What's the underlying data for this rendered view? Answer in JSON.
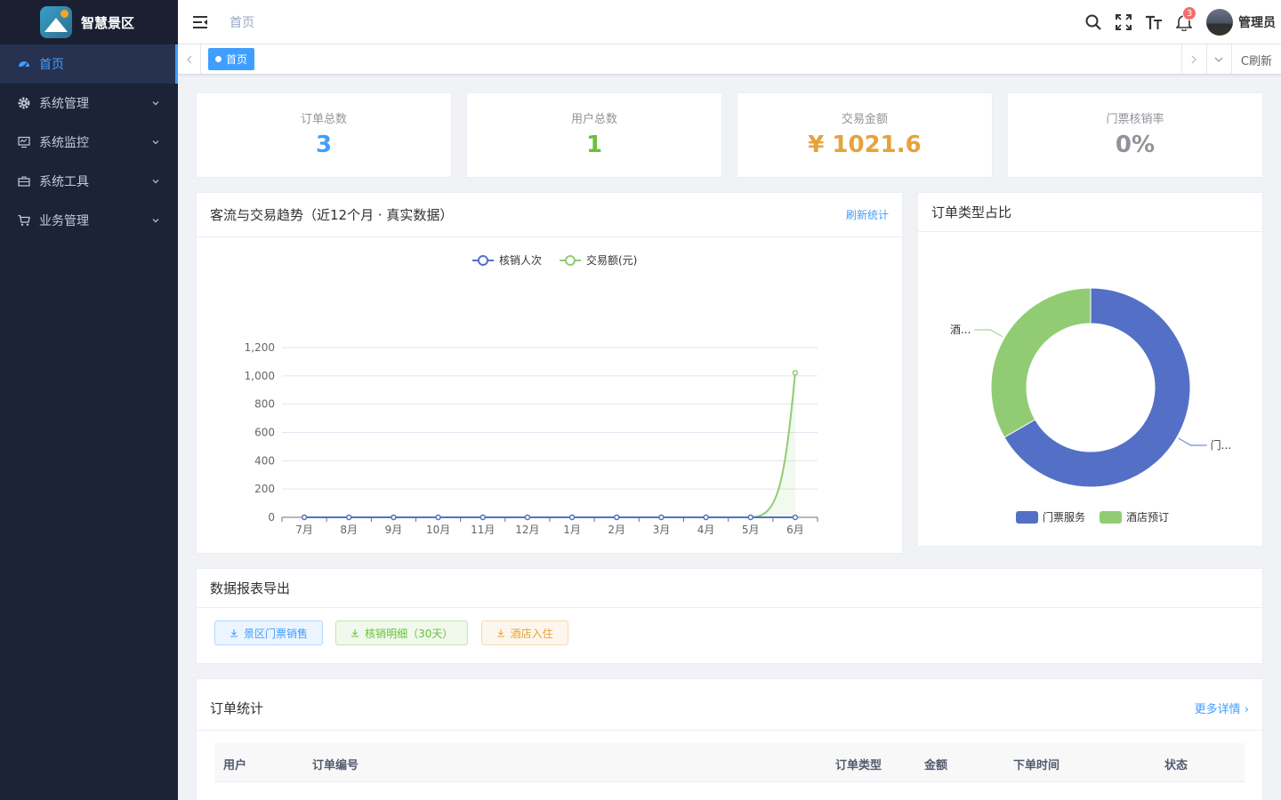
{
  "app": {
    "title": "智慧景区"
  },
  "sidebar": {
    "items": [
      {
        "label": "首页",
        "icon": "dashboard-icon",
        "active": true
      },
      {
        "label": "系统管理",
        "icon": "gear-icon"
      },
      {
        "label": "系统监控",
        "icon": "monitor-icon"
      },
      {
        "label": "系统工具",
        "icon": "toolbox-icon"
      },
      {
        "label": "业务管理",
        "icon": "cart-icon"
      }
    ]
  },
  "header": {
    "breadcrumb": "首页",
    "notification_count": "3",
    "username": "管理员"
  },
  "tags": {
    "active": "首页",
    "refresh_label": "C刷新"
  },
  "stats": [
    {
      "label": "订单总数",
      "value": "3",
      "color": "#409eff"
    },
    {
      "label": "用户总数",
      "value": "1",
      "color": "#67c23a"
    },
    {
      "label": "交易金额",
      "value": "¥ 1021.6",
      "color": "#e6a23c"
    },
    {
      "label": "门票核销率",
      "value": "0%",
      "color": "#909399"
    }
  ],
  "trend": {
    "title": "客流与交易趋势（近12个月 · 真实数据）",
    "link": "刷新统计"
  },
  "pie": {
    "title": "订单类型占比"
  },
  "export": {
    "title": "数据报表导出",
    "buttons": [
      "景区门票销售",
      "核销明细（30天）",
      "酒店入住"
    ]
  },
  "orders": {
    "title": "订单统计",
    "more": "更多详情 ›",
    "columns": [
      "用户",
      "订单编号",
      "订单类型",
      "金额",
      "下单时间",
      "状态"
    ]
  },
  "chart_data": [
    {
      "type": "line",
      "categories": [
        "7月",
        "8月",
        "9月",
        "10月",
        "11月",
        "12月",
        "1月",
        "2月",
        "3月",
        "4月",
        "5月",
        "6月"
      ],
      "series": [
        {
          "name": "核销人次",
          "color": "#5470c6",
          "values": [
            0,
            0,
            0,
            0,
            0,
            0,
            0,
            0,
            0,
            0,
            0,
            0
          ]
        },
        {
          "name": "交易额(元)",
          "color": "#91cc75",
          "values": [
            0,
            0,
            0,
            0,
            0,
            0,
            0,
            0,
            0,
            0,
            0,
            1021.6
          ]
        }
      ],
      "ylim": [
        0,
        1200
      ],
      "yticks": [
        "0",
        "200",
        "400",
        "600",
        "800",
        "1,000",
        "1,200"
      ],
      "grid": true,
      "legend": "top-center"
    },
    {
      "type": "pie",
      "donut": true,
      "slices": [
        {
          "label": "门票服务",
          "short": "门...",
          "value": 2,
          "color": "#5470c6"
        },
        {
          "label": "酒店预订",
          "short": "酒...",
          "value": 1,
          "color": "#91cc75"
        }
      ],
      "legend": "bottom-center"
    }
  ]
}
